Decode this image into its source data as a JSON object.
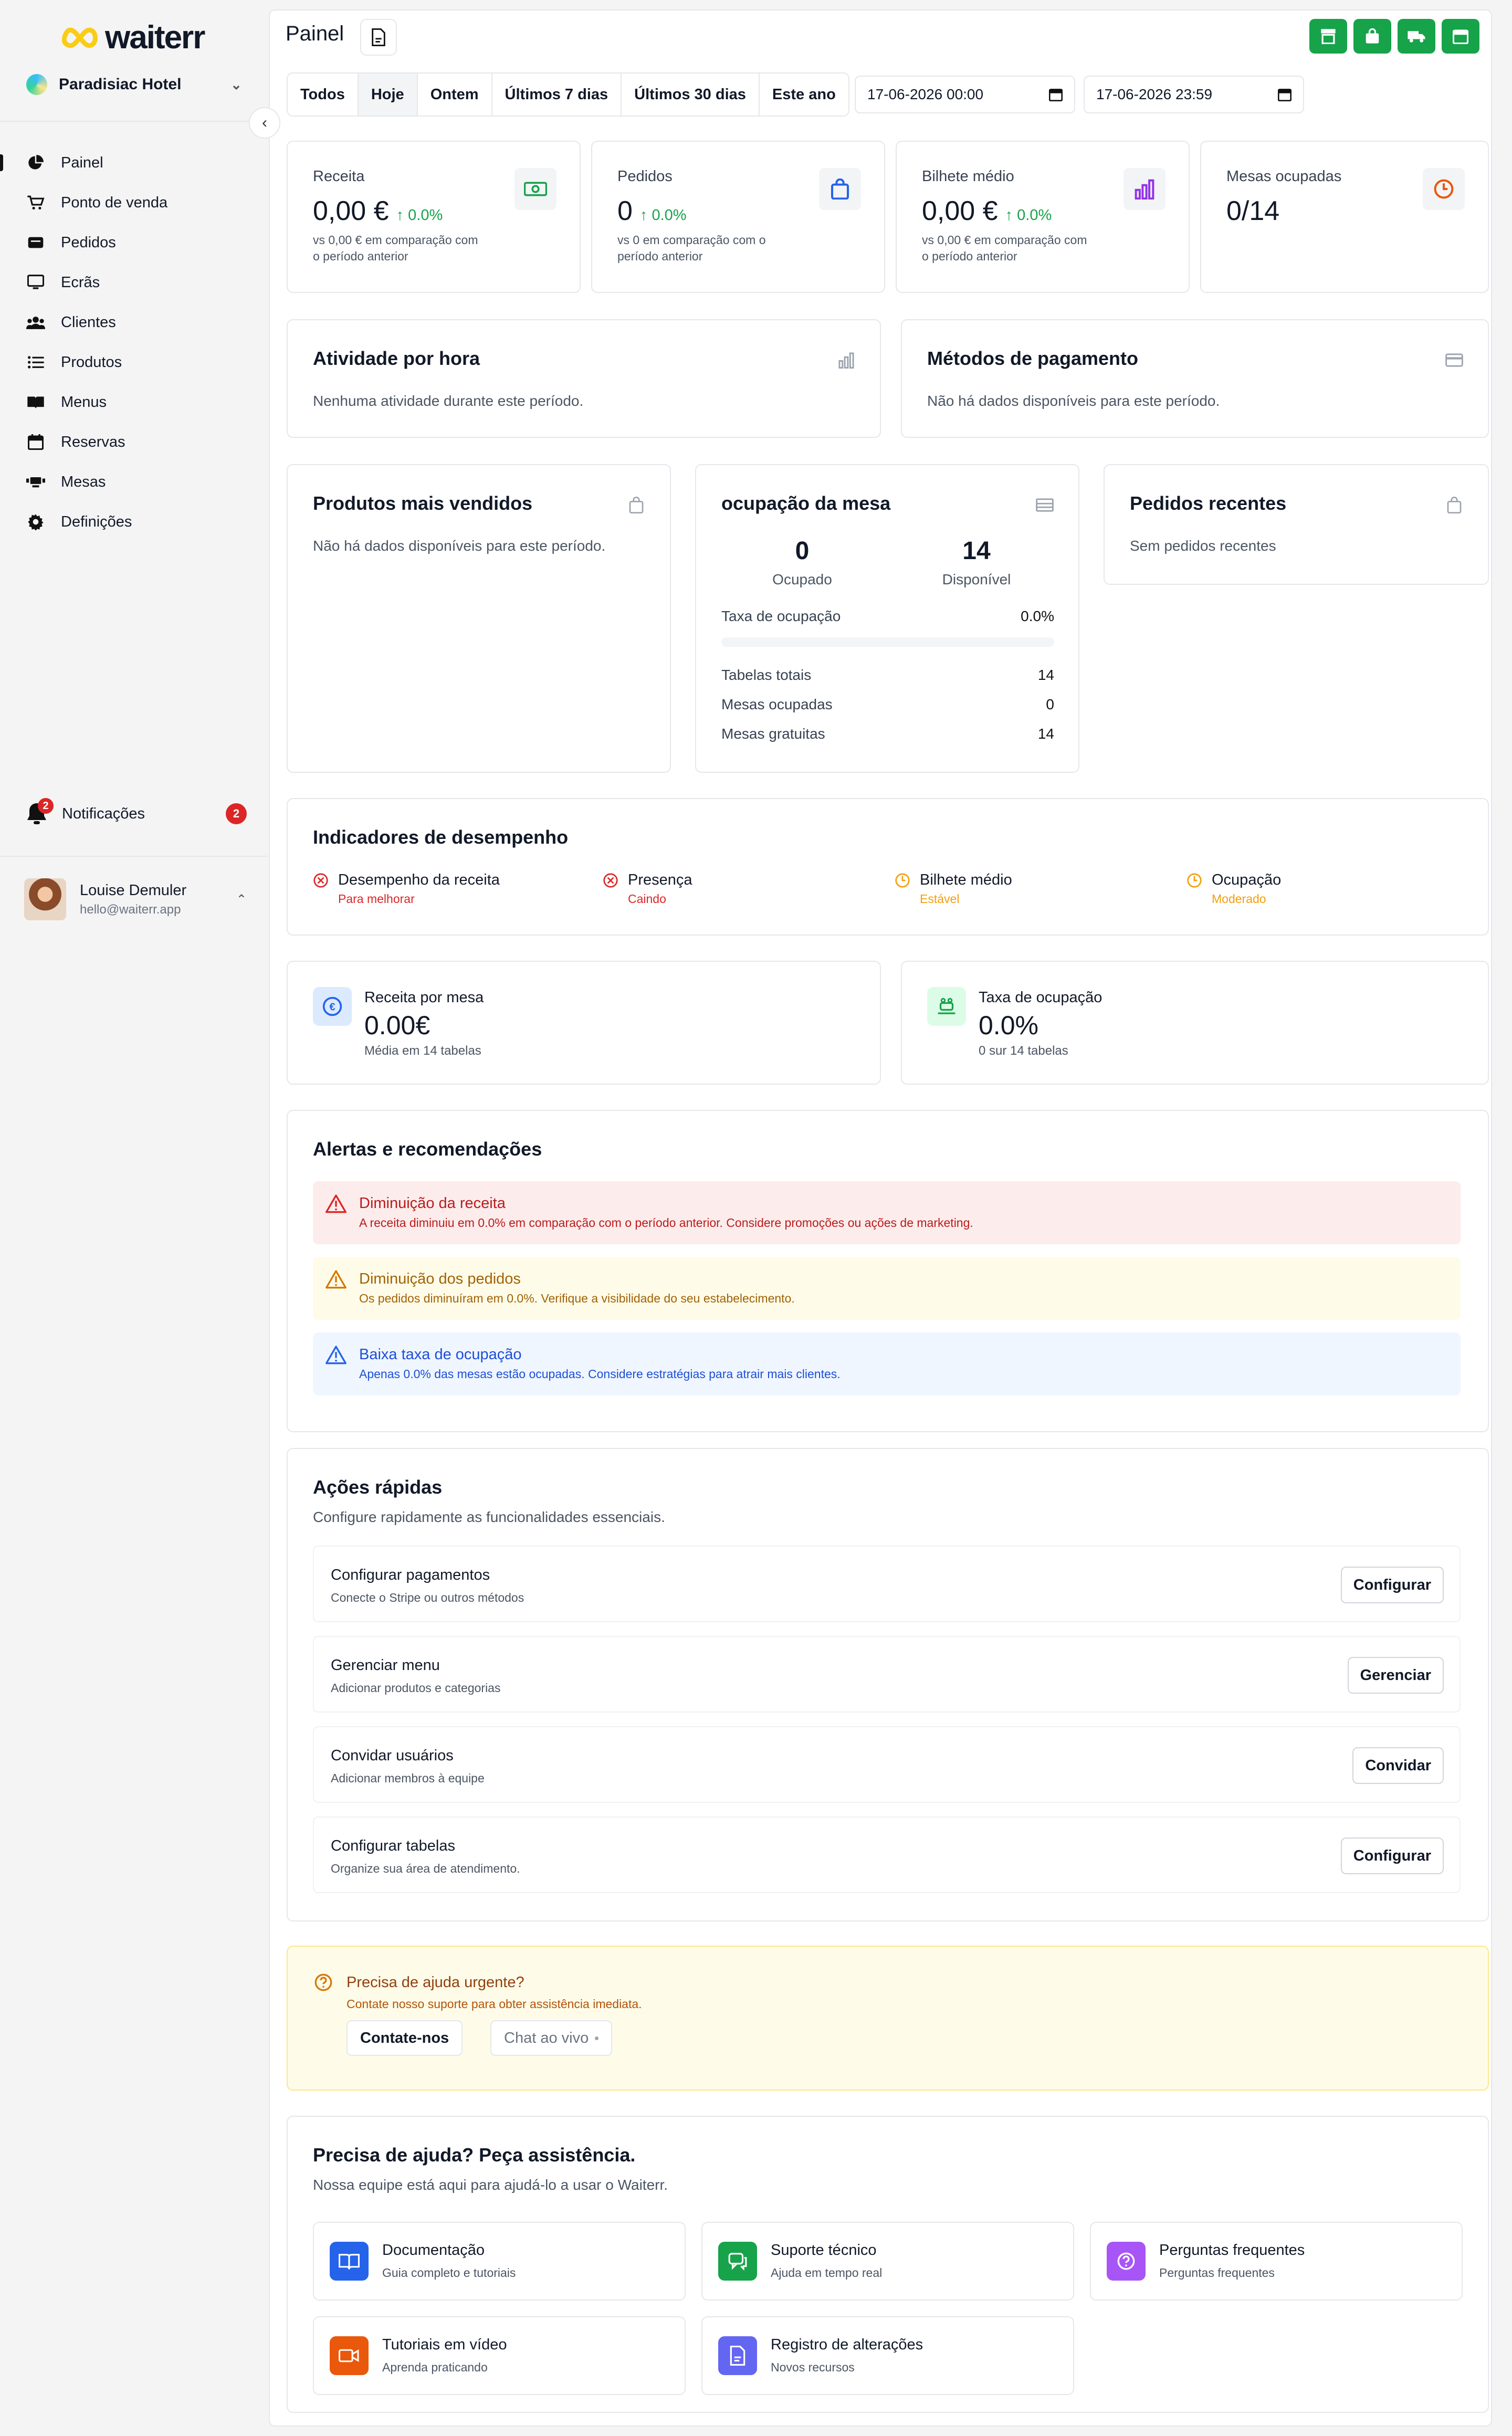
{
  "app": {
    "logo_text": "waiterr"
  },
  "hotel": {
    "name": "Paradisiac Hotel"
  },
  "nav": [
    {
      "label": "Painel",
      "icon": "pie-chart-icon",
      "active": true
    },
    {
      "label": "Ponto de venda",
      "icon": "cart-icon"
    },
    {
      "label": "Pedidos",
      "icon": "orders-icon"
    },
    {
      "label": "Ecrãs",
      "icon": "monitor-icon"
    },
    {
      "label": "Clientes",
      "icon": "users-icon"
    },
    {
      "label": "Produtos",
      "icon": "list-icon"
    },
    {
      "label": "Menus",
      "icon": "book-icon"
    },
    {
      "label": "Reservas",
      "icon": "calendar-icon"
    },
    {
      "label": "Mesas",
      "icon": "table-icon"
    },
    {
      "label": "Definições",
      "icon": "gear-icon"
    }
  ],
  "notifications": {
    "label": "Notificações",
    "badge": "2",
    "count": "2"
  },
  "user": {
    "name": "Louise Demuler",
    "email": "hello@waiterr.app"
  },
  "header": {
    "title": "Painel"
  },
  "filters": {
    "periods": [
      "Todos",
      "Hoje",
      "Ontem",
      "Últimos 7 dias",
      "Últimos 30 dias",
      "Este ano"
    ],
    "selected": "Hoje",
    "start": "17-06-2026 00:00",
    "end": "17-06-2026 23:59"
  },
  "kpis": [
    {
      "label": "Receita",
      "value": "0,00 €",
      "change": "0.0%",
      "sub": "vs 0,00 € em comparação com o período anterior",
      "icon": "money-icon",
      "color": "#16a34a"
    },
    {
      "label": "Pedidos",
      "value": "0",
      "change": "0.0%",
      "sub": "vs 0 em comparação com o período anterior",
      "icon": "bag-icon",
      "color": "#2563eb"
    },
    {
      "label": "Bilhete médio",
      "value": "0,00 €",
      "change": "0.0%",
      "sub": "vs 0,00 € em comparação com o período anterior",
      "icon": "bar-chart-icon",
      "color": "#9333ea"
    },
    {
      "label": "Mesas ocupadas",
      "value": "0/14",
      "change": "",
      "sub": "",
      "icon": "clock-icon",
      "color": "#ea580c"
    }
  ],
  "activity": {
    "title": "Atividade por hora",
    "empty": "Nenhuma atividade durante este período."
  },
  "payments": {
    "title": "Métodos de pagamento",
    "empty": "Não há dados disponíveis para este período."
  },
  "top_products": {
    "title": "Produtos mais vendidos",
    "empty": "Não há dados disponíveis para este período."
  },
  "occupancy": {
    "title": "ocupação da mesa",
    "occupied_value": "0",
    "occupied_label": "Ocupado",
    "available_value": "14",
    "available_label": "Disponível",
    "rate_label": "Taxa de ocupação",
    "rate_value": "0.0%",
    "rate_fraction": 0.0,
    "rows": [
      {
        "label": "Tabelas totais",
        "value": "14"
      },
      {
        "label": "Mesas ocupadas",
        "value": "0"
      },
      {
        "label": "Mesas gratuitas",
        "value": "14"
      }
    ]
  },
  "recent_orders": {
    "title": "Pedidos recentes",
    "empty": "Sem pedidos recentes"
  },
  "performance": {
    "title": "Indicadores de desempenho",
    "items": [
      {
        "label": "Desempenho da receita",
        "status": "Para melhorar",
        "color": "#dc2626",
        "icon": "x-circle-icon"
      },
      {
        "label": "Presença",
        "status": "Caindo",
        "color": "#dc2626",
        "icon": "x-circle-icon"
      },
      {
        "label": "Bilhete médio",
        "status": "Estável",
        "color": "#f59e0b",
        "icon": "clock-icon"
      },
      {
        "label": "Ocupação",
        "status": "Moderado",
        "color": "#f59e0b",
        "icon": "clock-icon"
      }
    ]
  },
  "metrics": [
    {
      "label": "Receita por mesa",
      "value": "0.00€",
      "sub": "Média em 14 tabelas",
      "icon": "euro-icon"
    },
    {
      "label": "Taxa de ocupação",
      "value": "0.0%",
      "sub": "0 sur 14 tabelas",
      "icon": "dining-icon"
    }
  ],
  "alerts": {
    "title": "Alertas e recomendações",
    "items": [
      {
        "title": "Diminuição da receita",
        "desc": "A receita diminuiu em 0.0% em comparação com o período anterior. Considere promoções ou ações de marketing.",
        "kind": "danger"
      },
      {
        "title": "Diminuição dos pedidos",
        "desc": "Os pedidos diminuíram em 0.0%. Verifique a visibilidade do seu estabelecimento.",
        "kind": "warning"
      },
      {
        "title": "Baixa taxa de ocupação",
        "desc": "Apenas 0.0% das mesas estão ocupadas. Considere estratégias para atrair mais clientes.",
        "kind": "info"
      }
    ]
  },
  "quick_actions": {
    "title": "Ações rápidas",
    "subtitle": "Configure rapidamente as funcionalidades essenciais.",
    "items": [
      {
        "title": "Configurar pagamentos",
        "sub": "Conecte o Stripe ou outros métodos",
        "button": "Configurar"
      },
      {
        "title": "Gerenciar menu",
        "sub": "Adicionar produtos e categorias",
        "button": "Gerenciar"
      },
      {
        "title": "Convidar usuários",
        "sub": "Adicionar membros à equipe",
        "button": "Convidar"
      },
      {
        "title": "Configurar tabelas",
        "sub": "Organize sua área de atendimento.",
        "button": "Configurar"
      }
    ]
  },
  "urgent": {
    "title": "Precisa de ajuda urgente?",
    "sub": "Contate nosso suporte para obter assistência imediata.",
    "contact": "Contate-nos",
    "chat": "Chat ao vivo"
  },
  "assist": {
    "title": "Precisa de ajuda? Peça assistência.",
    "subtitle": "Nossa equipe está aqui para ajudá-lo a usar o Waiterr.",
    "items": [
      {
        "title": "Documentação",
        "sub": "Guia completo e tutoriais",
        "color": "#2563eb",
        "icon": "book-icon"
      },
      {
        "title": "Suporte técnico",
        "sub": "Ajuda em tempo real",
        "color": "#16a34a",
        "icon": "chat-icon"
      },
      {
        "title": "Perguntas frequentes",
        "sub": "Perguntas frequentes",
        "color": "#a855f7",
        "icon": "question-icon"
      },
      {
        "title": "Tutoriais em vídeo",
        "sub": "Aprenda praticando",
        "color": "#ea580c",
        "icon": "video-icon"
      },
      {
        "title": "Registro de alterações",
        "sub": "Novos recursos",
        "color": "#6366f1",
        "icon": "document-icon"
      }
    ]
  }
}
